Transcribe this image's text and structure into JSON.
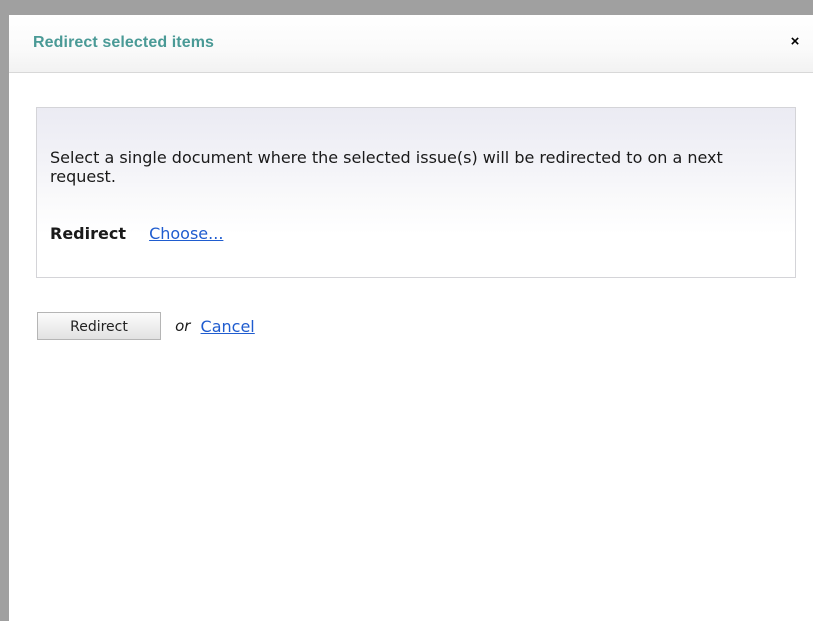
{
  "dialog": {
    "title": "Redirect selected items",
    "close_label": "×",
    "close_icon": "close-icon"
  },
  "panel": {
    "description": "Select a single document where the selected issue(s) will be redirected to on a next request.",
    "redirect_label": "Redirect",
    "choose_link": "Choose..."
  },
  "actions": {
    "redirect_button": "Redirect",
    "or_text": "or",
    "cancel_link": "Cancel"
  },
  "colors": {
    "title": "#4a9a96",
    "link": "#1f5ccf",
    "frame": "#a0a0a0"
  }
}
